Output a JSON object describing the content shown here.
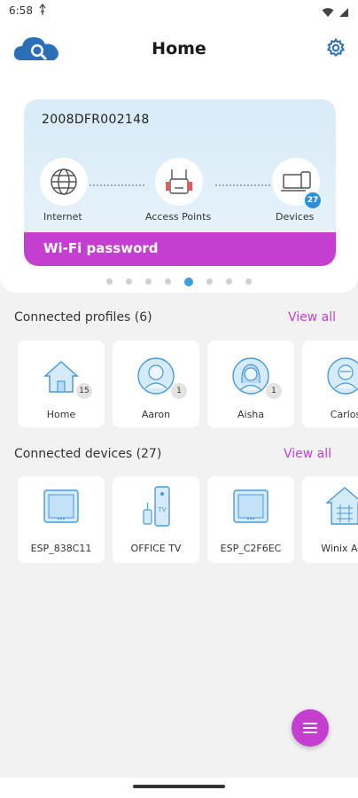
{
  "status_bar": {
    "time": "6:58"
  },
  "header": {
    "title": "Home"
  },
  "hero": {
    "serial": "2008DFR002148",
    "nodes": {
      "internet": "Internet",
      "access_points": "Access Points",
      "devices": "Devices"
    },
    "devices_badge": "27",
    "wifi_password_label": "Wi-Fi password",
    "page_dots": {
      "count": 8,
      "active_index": 4
    }
  },
  "profiles": {
    "title": "Connected profiles (6)",
    "view_all": "View all",
    "items": [
      {
        "name": "Home",
        "badge": "15",
        "icon": "house-icon"
      },
      {
        "name": "Aaron",
        "badge": "1",
        "icon": "person-icon"
      },
      {
        "name": "Aisha",
        "badge": "1",
        "icon": "person-icon"
      },
      {
        "name": "Carlos",
        "badge": "",
        "icon": "person-icon"
      }
    ]
  },
  "devices": {
    "title": "Connected devices (27)",
    "view_all": "View all",
    "items": [
      {
        "name": "ESP_838C11",
        "icon": "device-icon"
      },
      {
        "name": "OFFICE TV",
        "icon": "tv-icon"
      },
      {
        "name": "ESP_C2F6EC",
        "icon": "device-icon"
      },
      {
        "name": "Winix AirP",
        "icon": "smart-home-icon"
      }
    ]
  },
  "colors": {
    "accent": "#c43ed0",
    "blue": "#3d9be0",
    "hero_bg": "#dcecf8",
    "page_bg": "#f2f2f3"
  }
}
